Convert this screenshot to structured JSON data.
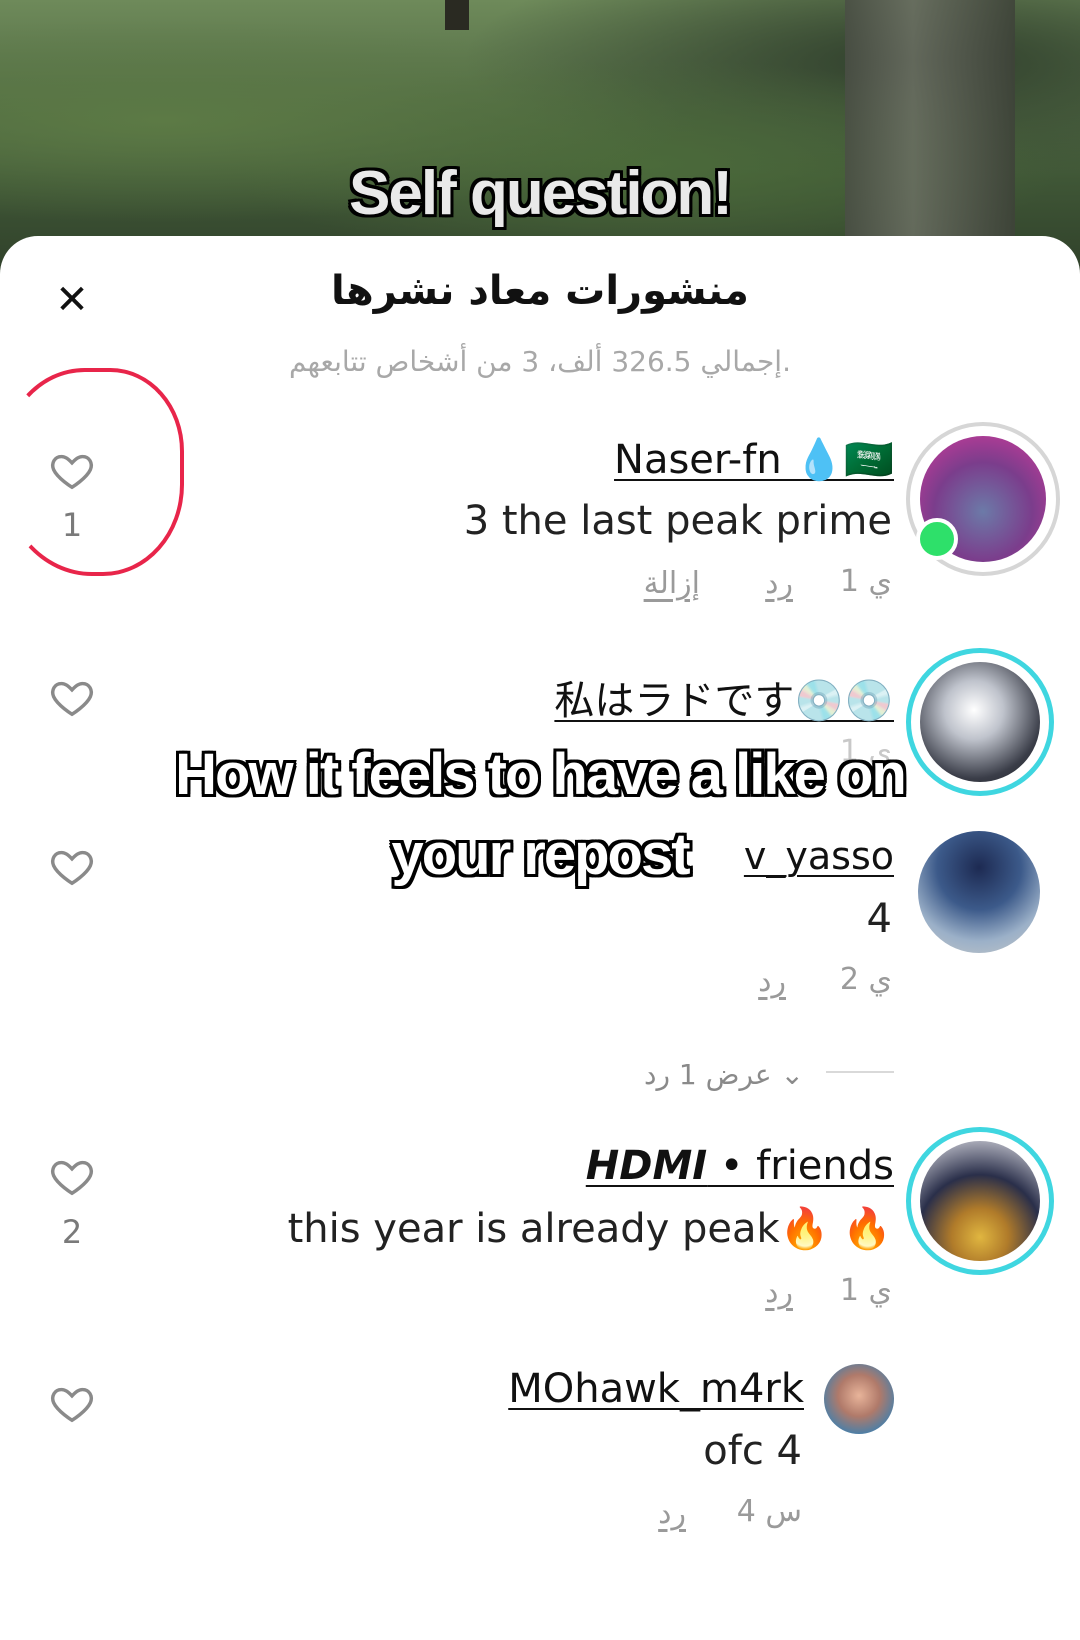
{
  "video": {
    "overlay_top": "Self question!",
    "caption_line1": "How it feels to have a like on",
    "caption_line2": "your repost"
  },
  "sheet": {
    "title": "منشورات معاد نشرها",
    "subtitle": "إجمالي 326.5 ألف، 3 من أشخاص تتابعهم.",
    "close_icon": "close-icon"
  },
  "comments": [
    {
      "username": "Naser-fn 💧🇸🇦",
      "text": "3 the last peak prime",
      "time": "1 ي",
      "reply": "رد",
      "remove": "إزالة",
      "likes": "1",
      "online": true
    },
    {
      "username": "私はラドです💿💿",
      "text": "",
      "time": "1 ي",
      "likes": ""
    },
    {
      "username": "v_yasso",
      "text": "4",
      "time": "2 ي",
      "reply": "رد",
      "likes": "",
      "view_replies": "عرض 1 رد"
    },
    {
      "username_italic": "HDMI",
      "username_rest": " • friends",
      "text": "this year is already peak🔥 🔥",
      "time": "1 ي",
      "reply": "رد",
      "likes": "2"
    },
    {
      "username": "MOhawk_m4rk",
      "text": "ofc 4",
      "time": "4 س",
      "reply": "رد",
      "likes": ""
    }
  ],
  "colors": {
    "annotation_circle": "#e8254a",
    "online_dot": "#2ee06a",
    "story_ring": "#3fd6e0"
  }
}
